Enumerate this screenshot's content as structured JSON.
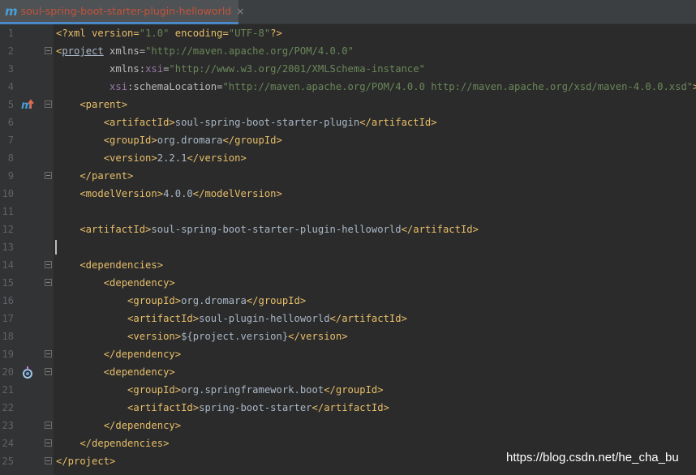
{
  "tab": {
    "icon": "maven-m-icon",
    "title": "soul-spring-boot-starter-plugin-helloworld",
    "close": "×"
  },
  "line_numbers": [
    "1",
    "2",
    "3",
    "4",
    "5",
    "6",
    "7",
    "8",
    "9",
    "10",
    "11",
    "12",
    "13",
    "14",
    "15",
    "16",
    "17",
    "18",
    "19",
    "20",
    "21",
    "22",
    "23",
    "24",
    "25"
  ],
  "code": {
    "l1": {
      "a": "<?xml version=",
      "b": "\"1.0\"",
      "c": " encoding=",
      "d": "\"UTF-8\"",
      "e": "?>"
    },
    "l2": {
      "a": "<",
      "b": "project",
      "c": " xmlns=",
      "d": "\"http://maven.apache.org/POM/4.0.0\""
    },
    "l3": {
      "a": "         xmlns:",
      "b": "xsi",
      "c": "=",
      "d": "\"http://www.w3.org/2001/XMLSchema-instance\""
    },
    "l4": {
      "a": "         ",
      "b": "xsi",
      "c": ":schemaLocation=",
      "d": "\"http://maven.apache.org/POM/4.0.0 http://maven.apache.org/xsd/maven-4.0.0.xsd\"",
      "e": ">"
    },
    "l5": {
      "a": "    <parent>"
    },
    "l6": {
      "a": "        <artifactId>",
      "b": "soul-spring-boot-starter-plugin",
      "c": "</artifactId>"
    },
    "l7": {
      "a": "        <groupId>",
      "b": "org.dromara",
      "c": "</groupId>"
    },
    "l8": {
      "a": "        <version>",
      "b": "2.2.1",
      "c": "</version>"
    },
    "l9": {
      "a": "    </parent>"
    },
    "l10": {
      "a": "    <modelVersion>",
      "b": "4.0.0",
      "c": "</modelVersion>"
    },
    "l12": {
      "a": "    <artifactId>",
      "b": "soul-spring-boot-starter-plugin-helloworld",
      "c": "</artifactId>"
    },
    "l14": {
      "a": "    <dependencies>"
    },
    "l15": {
      "a": "        <dependency>"
    },
    "l16": {
      "a": "            <groupId>",
      "b": "org.dromara",
      "c": "</groupId>"
    },
    "l17": {
      "a": "            <artifactId>",
      "b": "soul-plugin-helloworld",
      "c": "</artifactId>"
    },
    "l18": {
      "a": "            <version>",
      "b": "${project.version}",
      "c": "</version>"
    },
    "l19": {
      "a": "        </dependency>"
    },
    "l20": {
      "a": "        <dependency>"
    },
    "l21": {
      "a": "            <groupId>",
      "b": "org.springframework.boot",
      "c": "</groupId>"
    },
    "l22": {
      "a": "            <artifactId>",
      "b": "spring-boot-starter",
      "c": "</artifactId>"
    },
    "l23": {
      "a": "        </dependency>"
    },
    "l24": {
      "a": "    </dependencies>"
    },
    "l25": {
      "a": "</project>"
    }
  },
  "watermark": "https://blog.csdn.net/he_cha_bu",
  "colors": {
    "tag": "#e8bf6a",
    "value": "#6a8759",
    "namespace": "#9876aa",
    "text": "#a9b7c6",
    "background": "#2b2b2b",
    "gutter": "#313335"
  }
}
